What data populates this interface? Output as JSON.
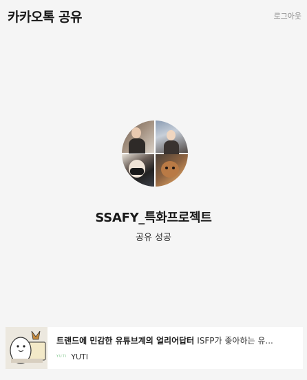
{
  "header": {
    "title": "카카오톡 공유",
    "logout_label": "로그아웃"
  },
  "share": {
    "room_name": "SSAFY_특화프로젝트",
    "status": "공유 성공"
  },
  "card": {
    "title": "트랜드에 민감한 유튜브계의 얼리어답터",
    "description": "ISFP가 좋아하는 유...",
    "source_name": "YUTI",
    "source_icon_text": "YUTI"
  }
}
